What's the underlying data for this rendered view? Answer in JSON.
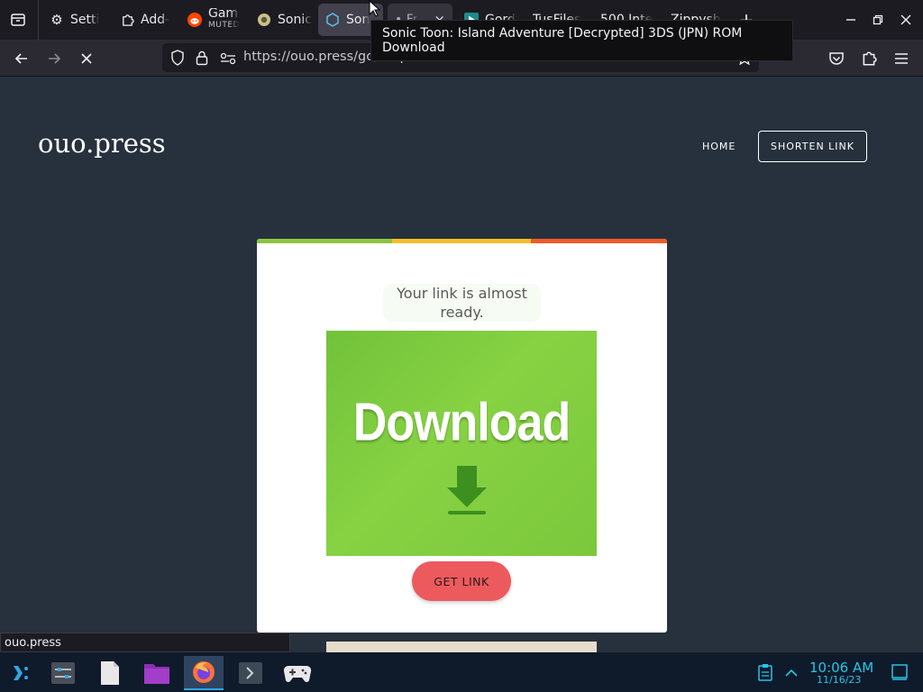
{
  "browser": {
    "tabs": [
      {
        "label": "Setti",
        "icon": "gear-icon"
      },
      {
        "label": "Add-",
        "icon": "puzzle-icon"
      },
      {
        "label": "Gam",
        "sublabel": "MUTED",
        "icon": "reddit-icon"
      },
      {
        "label": "Sonic",
        "icon": "sonic-icon"
      },
      {
        "label": "Son",
        "icon": "hexagon-icon"
      },
      {
        "label": "• Fr",
        "icon": "",
        "close": "×"
      },
      {
        "label": "Gord",
        "icon": "play-icon"
      },
      {
        "label": "TusFiles",
        "icon": ""
      },
      {
        "label": "500 Inte",
        "icon": ""
      },
      {
        "label": "Zippysh",
        "icon": ""
      }
    ],
    "new_tab": "+",
    "list_all_tabs": "⌄",
    "url": "https://ouo.press/go/nnqCN",
    "tooltip": "Sonic Toon: Island Adventure [Decrypted] 3DS (JPN) ROM Download",
    "status_text": "ouo.press"
  },
  "site": {
    "logo": "ouo.press",
    "nav_home": "HOME",
    "nav_shorten": "SHORTEN LINK",
    "ready_message": "Your link is almost ready.",
    "image_word": "Download",
    "button_label": "GET LINK",
    "stripe_colors": [
      "#8dc43f",
      "#f7bd2a",
      "#ef5b2a"
    ]
  },
  "taskbar": {
    "time": "10:06 AM",
    "date": "11/16/23"
  }
}
